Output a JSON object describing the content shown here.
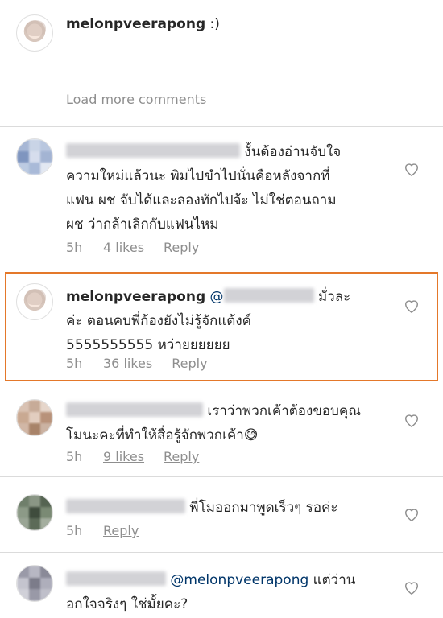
{
  "caption": {
    "username": "melonpveerapong",
    "text": ":)"
  },
  "load_more": "Load more comments",
  "comments": [
    {
      "lines": [
        "งั้นต้องอ่านจับใจ",
        "ความใหม่แล้วนะ พิมไปขำไปนั่นคือหลังจากที่",
        "แฟน ผช จับได้และลองทักไปจ้ะ ไม่ใช่ตอนถาม",
        "ผช ว่ากล้าเลิกกับแฟนไหม"
      ],
      "time": "5h",
      "likes": "4 likes",
      "reply": "Reply"
    },
    {
      "username": "melonpveerapong",
      "mention": "@",
      "lines": [
        "มั่วละ",
        "ค่ะ ตอนคบพี่ก้องยังไม่รู้จักแต้งค์",
        "5555555555 หว่ายยยยยย"
      ],
      "time": "5h",
      "likes": "36 likes",
      "reply": "Reply"
    },
    {
      "lines": [
        "เราว่าพวกเค้าต้องขอบคุณ",
        "โมนะคะที่ทำให้สื่อรู้จักพวกเค้า😅"
      ],
      "time": "5h",
      "likes": "9 likes",
      "reply": "Reply"
    },
    {
      "lines": [
        "พี่โมออกมาพูดเร็วๆ รอค่ะ"
      ],
      "time": "5h",
      "reply": "Reply"
    },
    {
      "mention": "@melonpveerapong",
      "lines": [
        "แต่ว่าน",
        "อกใจจริงๆ ใช่มั้ยคะ?"
      ]
    }
  ],
  "colors": {
    "highlight": "#e4782a",
    "meta": "#8e8e8e",
    "text": "#262626"
  },
  "icons": [
    "heart-outline-icon"
  ]
}
